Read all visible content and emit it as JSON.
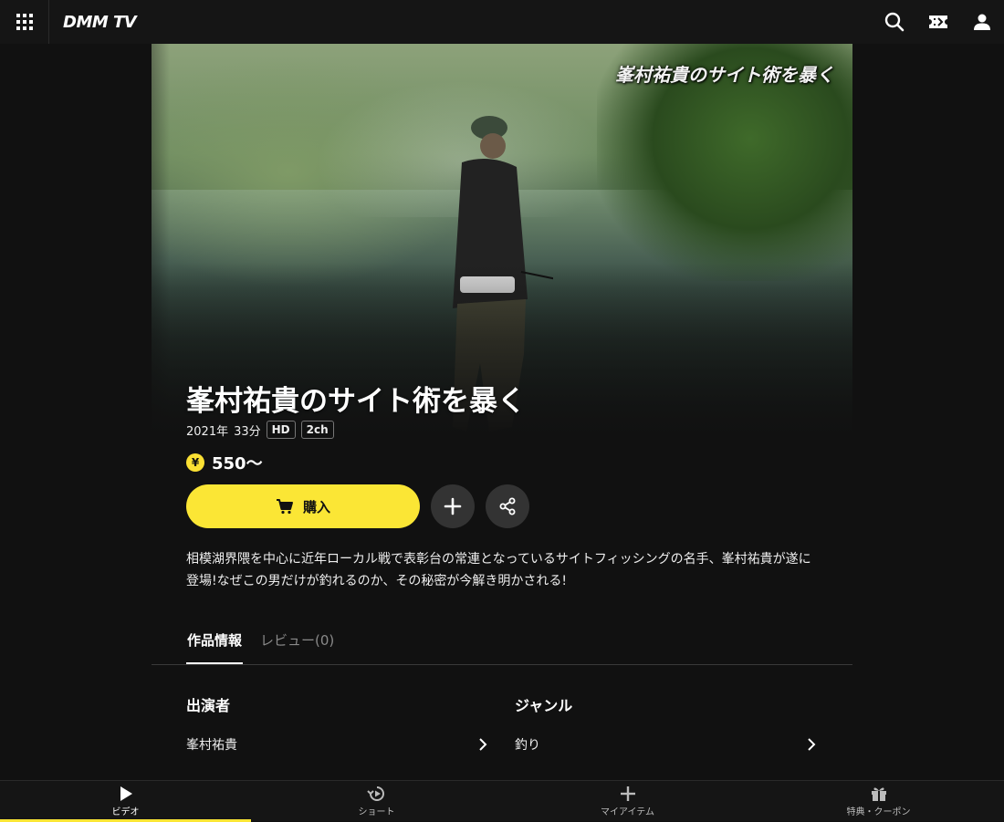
{
  "header": {
    "logo": "DMM TV",
    "icons": [
      "grid-icon",
      "search-icon",
      "ticket-icon",
      "user-icon"
    ]
  },
  "hero": {
    "overlay_title": "峯村祐貴のサイト術を暴く"
  },
  "content": {
    "title": "峯村祐貴のサイト術を暴く",
    "year": "2021年",
    "duration": "33分",
    "badges": [
      "HD",
      "2ch"
    ],
    "price_symbol": "¥",
    "price": "550〜",
    "buy_label": "購入",
    "description_line1": "相模湖界隈を中心に近年ローカル戦で表彰台の常連となっているサイトフィッシングの名手、峯村祐貴が遂に",
    "description_line2": "登場!なぜこの男だけが釣れるのか、その秘密が今解き明かされる!"
  },
  "tabs": [
    {
      "label": "作品情報",
      "active": true
    },
    {
      "label": "レビュー(0)",
      "active": false
    }
  ],
  "info": {
    "cast_heading": "出演者",
    "cast_value": "峯村祐貴",
    "genre_heading": "ジャンル",
    "genre_value": "釣り"
  },
  "bottom_nav": [
    {
      "label": "ビデオ",
      "icon": "play-icon",
      "active": true
    },
    {
      "label": "ショート",
      "icon": "short-play-icon",
      "active": false
    },
    {
      "label": "マイアイテム",
      "icon": "plus-icon",
      "active": false
    },
    {
      "label": "特典・クーポン",
      "icon": "gift-icon",
      "active": false
    }
  ],
  "colors": {
    "accent": "#fbe635",
    "background": "#111111",
    "button_dark": "#333333"
  }
}
